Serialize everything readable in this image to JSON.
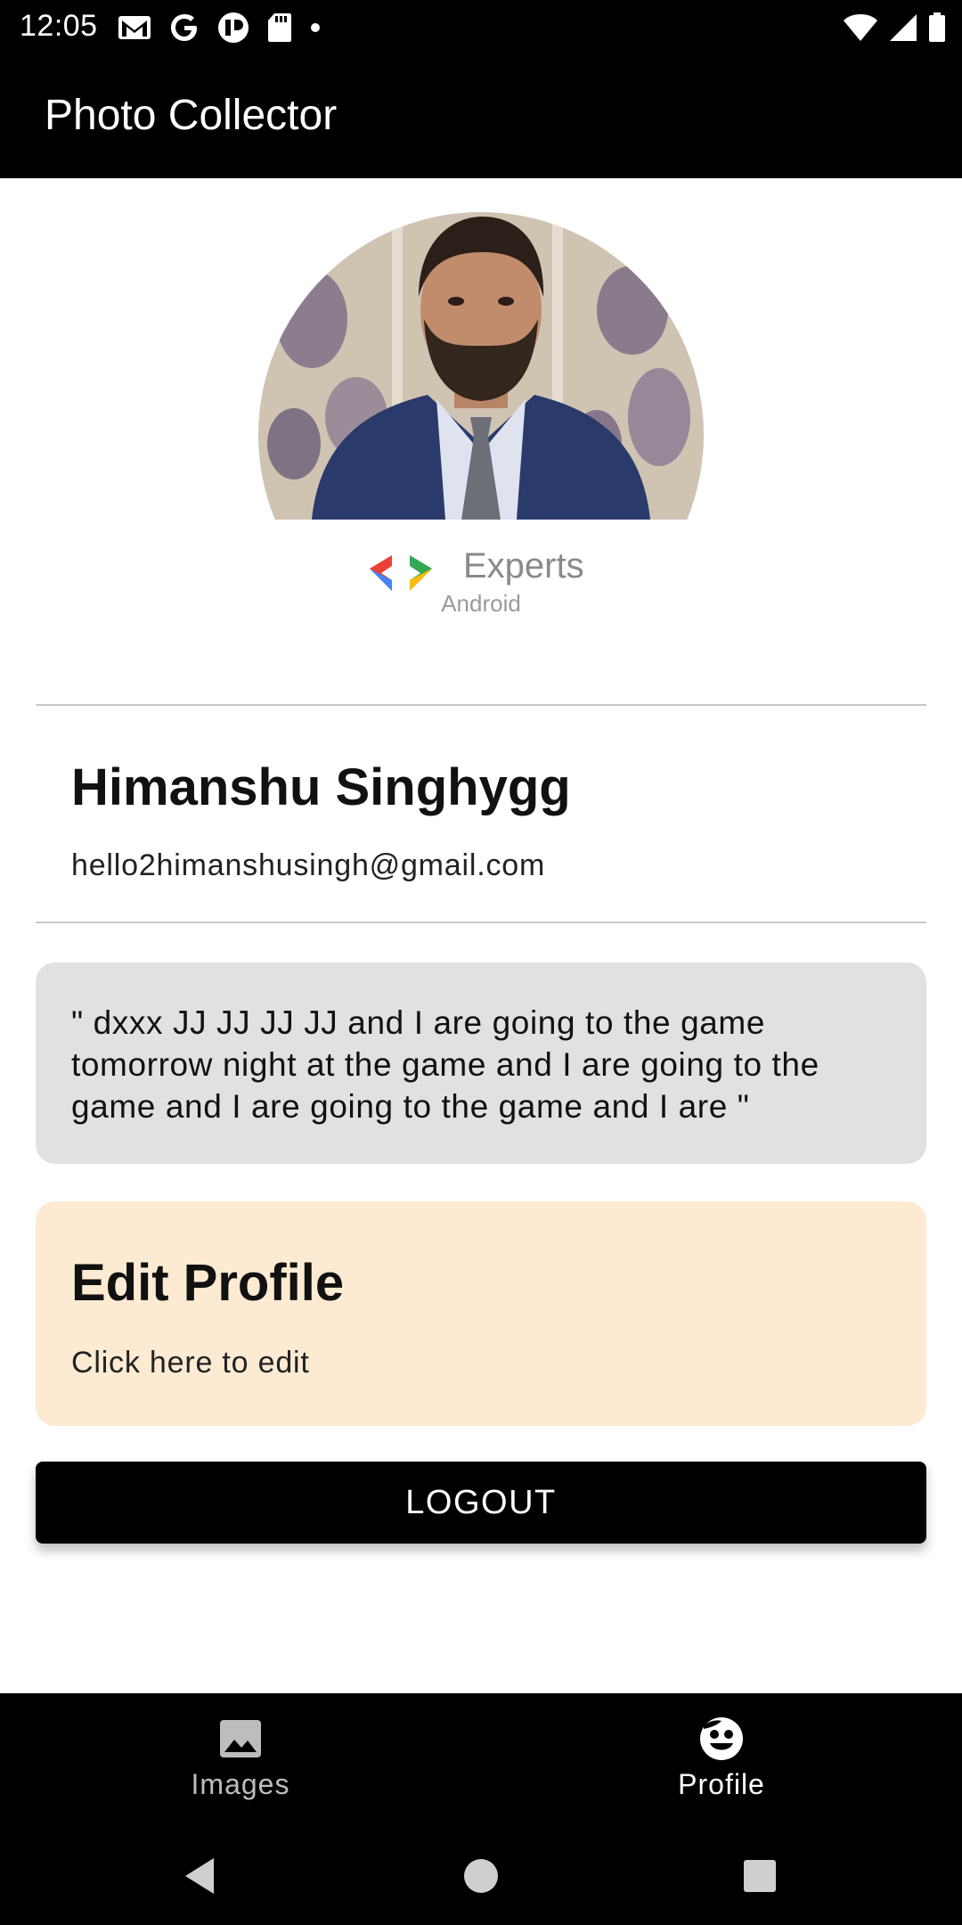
{
  "status_bar": {
    "time": "12:05",
    "left_icons": [
      "gmail-icon",
      "google-icon",
      "app-icon",
      "sd-card-icon",
      "dot-icon"
    ],
    "right_icons": [
      "wifi-icon",
      "signal-icon",
      "battery-icon"
    ]
  },
  "app_bar": {
    "title": "Photo Collector"
  },
  "profile": {
    "avatar_badge_text": "Experts",
    "avatar_badge_sub": "Android",
    "name": "Himanshu Singhygg",
    "email": "hello2himanshusingh@gmail.com",
    "about": "\" dxxx JJ JJ JJ JJ and I are going to the game tomorrow night at the game and I are going to the game and I are going to the game and I are \""
  },
  "edit_card": {
    "title": "Edit Profile",
    "subtitle": "Click here to edit"
  },
  "logout_label": "LOGOUT",
  "bottom_nav": [
    {
      "label": "Images",
      "icon": "image-icon",
      "selected": false
    },
    {
      "label": "Profile",
      "icon": "face-icon",
      "selected": true
    }
  ],
  "system_nav": [
    "back-icon",
    "home-icon",
    "recents-icon"
  ],
  "colors": {
    "bar_background": "#000000",
    "about_card": "#e1e1e1",
    "edit_card": "#fcebd2",
    "logout_button": "#000000"
  }
}
